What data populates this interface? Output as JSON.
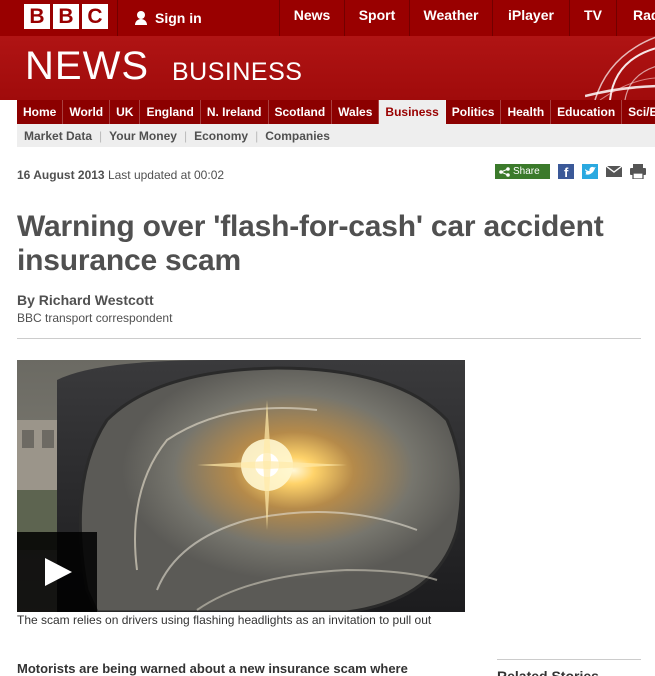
{
  "brand": {
    "logo_letters": [
      "B",
      "B",
      "C"
    ],
    "signin_label": "Sign in",
    "colors": {
      "brand_red": "#990000",
      "banner_red": "#a50f0f",
      "share_green": "#3b7a2b"
    }
  },
  "top_nav": [
    "News",
    "Sport",
    "Weather",
    "iPlayer",
    "TV",
    "Radio"
  ],
  "banner": {
    "site": "NEWS",
    "section": "BUSINESS"
  },
  "section_nav": [
    {
      "label": "Home",
      "active": false
    },
    {
      "label": "World",
      "active": false
    },
    {
      "label": "UK",
      "active": false
    },
    {
      "label": "England",
      "active": false
    },
    {
      "label": "N. Ireland",
      "active": false
    },
    {
      "label": "Scotland",
      "active": false
    },
    {
      "label": "Wales",
      "active": false
    },
    {
      "label": "Business",
      "active": true
    },
    {
      "label": "Politics",
      "active": false
    },
    {
      "label": "Health",
      "active": false
    },
    {
      "label": "Education",
      "active": false
    },
    {
      "label": "Sci/Environment",
      "active": false
    }
  ],
  "sub_nav": [
    "Market Data",
    "Your Money",
    "Economy",
    "Companies"
  ],
  "dateline": {
    "date": "16 August 2013",
    "updated": "Last updated at 00:02"
  },
  "share": {
    "label": "Share",
    "icons": [
      "facebook-icon",
      "twitter-icon",
      "email-icon",
      "print-icon"
    ]
  },
  "article": {
    "headline": "Warning over 'flash-for-cash' car accident insurance scam",
    "author": "By Richard Westcott",
    "role": "BBC transport correspondent",
    "caption": "The scam relies on drivers using flashing headlights as an invitation to pull out",
    "lead": "Motorists are being warned about a new insurance scam where"
  },
  "sidebar": {
    "heading": "Related Stories"
  }
}
